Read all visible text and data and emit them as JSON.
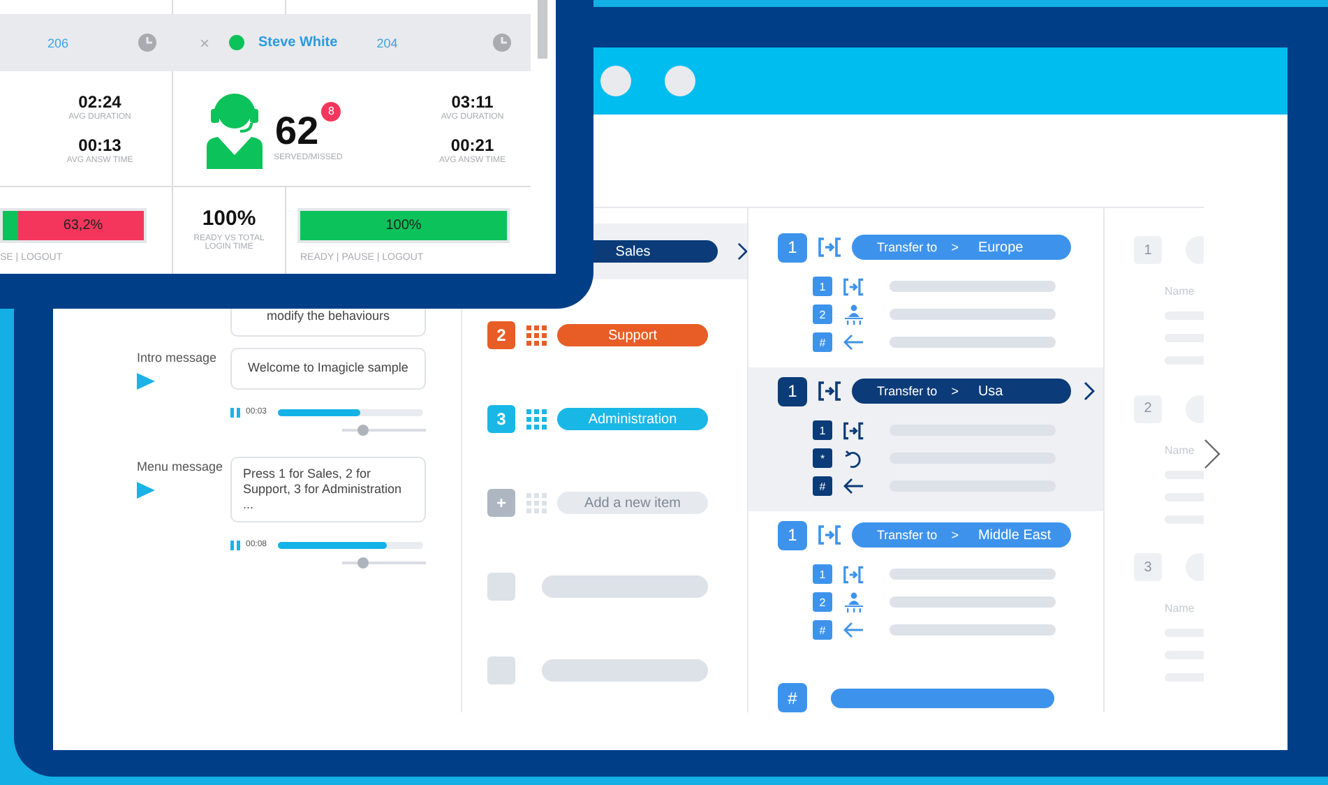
{
  "dashboard": {
    "agent_cut_off": {
      "extension": "206",
      "stats": [
        {
          "value": "02:24",
          "label": "AVG DURATION"
        },
        {
          "value": "00:13",
          "label": "AVG ANSW TIME"
        }
      ],
      "ready_bar": {
        "level": 0.11,
        "reading": "63,2%"
      },
      "legend": "SE | LOGOUT"
    },
    "agent": {
      "close": "×",
      "online": true,
      "name": "Steve White",
      "extension": "204",
      "served": "62",
      "missed": "8",
      "served_label": "SERVED/MISSED",
      "stats": [
        {
          "value": "03:11",
          "label": "AVG DURATION"
        },
        {
          "value": "00:21",
          "label": "AVG ANSW TIME"
        }
      ],
      "ready_total": "100%",
      "ready_total_label": "READY VS TOTAL LOGIN TIME",
      "ready_bar": {
        "level": 1,
        "reading": "100%"
      },
      "legend": "READY | PAUSE | LOGOUT"
    }
  },
  "ivr_editor": {
    "messages": [
      {
        "kind": "text",
        "text": "modify the behaviours"
      },
      {
        "kind": "audio",
        "label": "Intro message",
        "text": "Welcome to Imagicle sample",
        "time": "00:03",
        "level": 0.57,
        "volume": {
          "level": 0.25
        }
      },
      {
        "kind": "audio",
        "label": "Menu message",
        "text": "Press 1 for Sales, 2 for Support, 3 for Administration ...",
        "time": "00:08",
        "level": 0.75,
        "volume": {
          "level": 0.25
        }
      }
    ],
    "menu_items": [
      {
        "kind": "option",
        "label": "Sales",
        "color": "#0b3b78",
        "selected": true
      },
      {
        "kind": "option",
        "number": "2",
        "label": "Support",
        "color": "#e85d26",
        "selected": false
      },
      {
        "kind": "option",
        "number": "3",
        "label": "Administration",
        "color": "#19b7e6",
        "selected": false
      },
      {
        "kind": "add",
        "number": "+",
        "label": "Add a new item"
      },
      {
        "kind": "placeholder"
      },
      {
        "kind": "placeholder"
      }
    ],
    "transfer_groups": [
      {
        "number": "1",
        "action": "Transfer to",
        "separator": ">",
        "destination": "Europe",
        "selected": false,
        "keys": [
          {
            "key": "1",
            "kind": "transfer"
          },
          {
            "key": "2",
            "kind": "queue"
          },
          {
            "key": "#",
            "kind": "back"
          }
        ]
      },
      {
        "number": "1",
        "action": "Transfer to",
        "separator": ">",
        "destination": "Usa",
        "selected": true,
        "keys": [
          {
            "key": "1",
            "kind": "transfer"
          },
          {
            "key": "*",
            "kind": "repeat"
          },
          {
            "key": "#",
            "kind": "back"
          }
        ]
      },
      {
        "number": "1",
        "action": "Transfer to",
        "separator": ">",
        "destination": "Middle East",
        "selected": false,
        "keys": [
          {
            "key": "1",
            "kind": "transfer"
          },
          {
            "key": "2",
            "kind": "queue"
          },
          {
            "key": "#",
            "kind": "back"
          }
        ]
      }
    ],
    "footer_key": "#",
    "detail_items": [
      {
        "number": "1",
        "label": "Name"
      },
      {
        "number": "2",
        "label": "Name"
      },
      {
        "number": "3",
        "label": "Name"
      }
    ]
  }
}
